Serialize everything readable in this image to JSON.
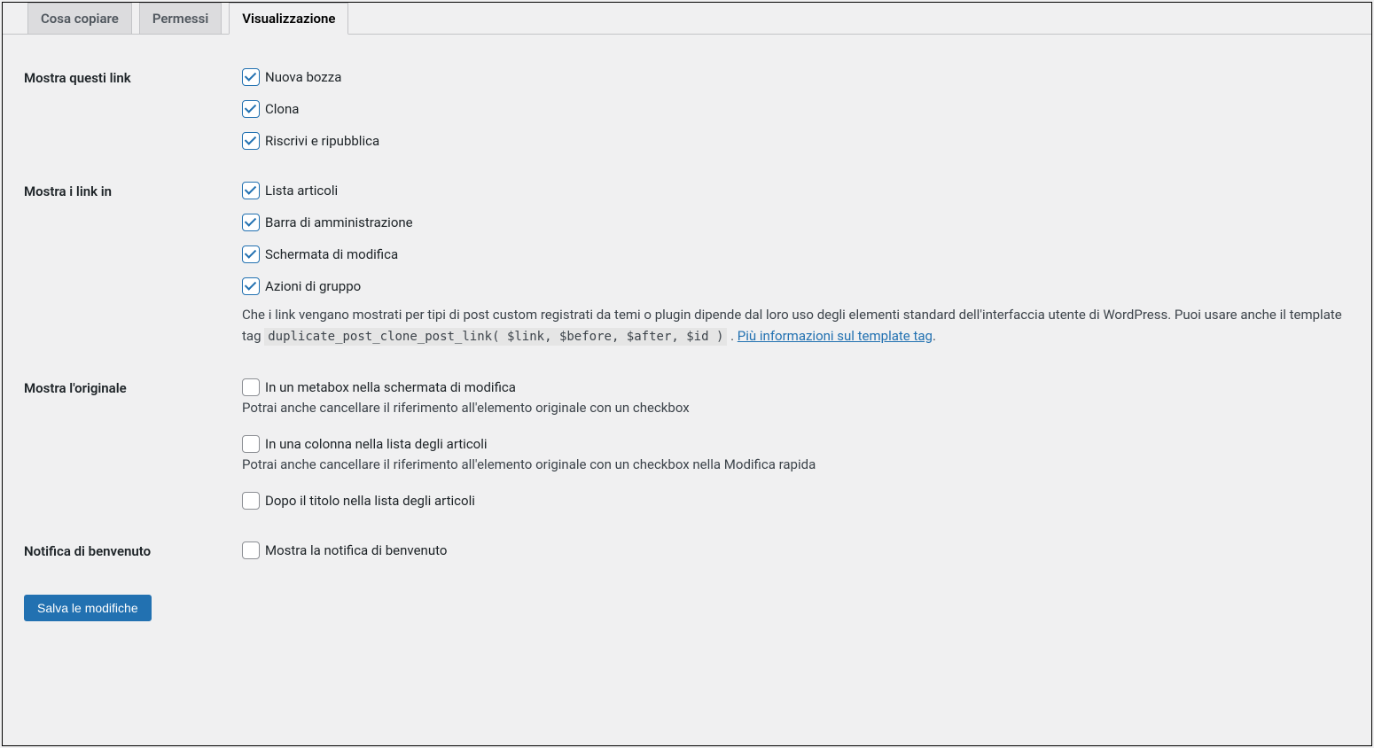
{
  "tabs": {
    "copy": "Cosa copiare",
    "permissions": "Permessi",
    "display": "Visualizzazione"
  },
  "sections": {
    "show_links": {
      "heading": "Mostra questi link",
      "options": {
        "new_draft": "Nuova bozza",
        "clone": "Clona",
        "rewrite_republish": "Riscrivi e ripubblica"
      }
    },
    "show_links_in": {
      "heading": "Mostra i link in",
      "options": {
        "post_list": "Lista articoli",
        "admin_bar": "Barra di amministrazione",
        "edit_screen": "Schermata di modifica",
        "bulk_actions": "Azioni di gruppo"
      },
      "description_before": "Che i link vengano mostrati per tipi di post custom registrati da temi o plugin dipende dal loro uso degli elementi standard dell'interfaccia utente di WordPress. Puoi usare anche il template tag ",
      "description_code": "duplicate_post_clone_post_link( $link, $before, $after, $id )",
      "description_after": " . ",
      "description_link": "Più informazioni sul template tag",
      "description_end": "."
    },
    "show_original": {
      "heading": "Mostra l'originale",
      "options": {
        "metabox": "In un metabox nella schermata di modifica",
        "metabox_desc": "Potrai anche cancellare il riferimento all'elemento originale con un checkbox",
        "column": "In una colonna nella lista degli articoli",
        "column_desc": "Potrai anche cancellare il riferimento all'elemento originale con un checkbox nella Modifica rapida",
        "after_title": "Dopo il titolo nella lista degli articoli"
      }
    },
    "welcome_notice": {
      "heading": "Notifica di benvenuto",
      "option": "Mostra la notifica di benvenuto"
    }
  },
  "submit": "Salva le modifiche"
}
